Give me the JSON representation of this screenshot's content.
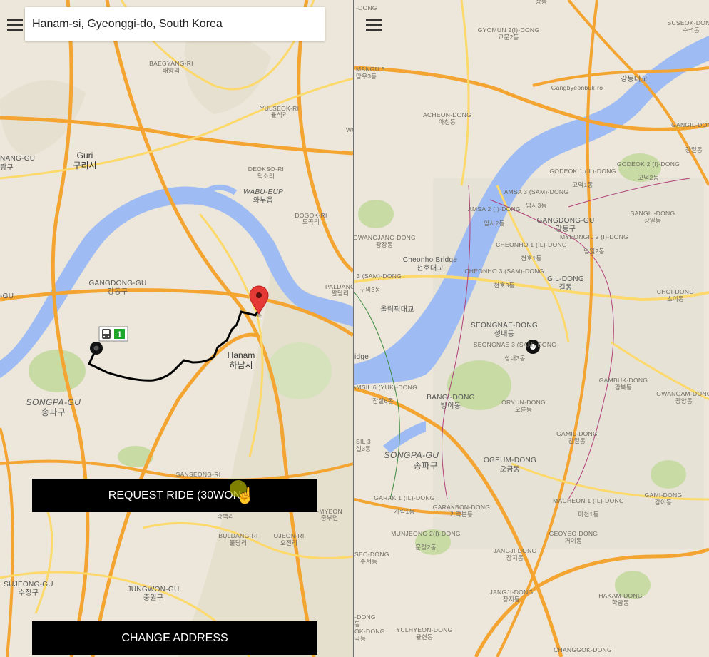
{
  "search": {
    "value": "Hanam-si, Gyeonggi-do, South Korea"
  },
  "buttons": {
    "request_ride": "REQUEST RIDE (30WON",
    "change_address": "CHANGE ADDRESS"
  },
  "left_map": {
    "transit_badge": "1",
    "labels": {
      "guri_en": "Guri",
      "guri_ko": "구리시",
      "baegyang_en": "BAEGYANG-RI",
      "baegyang_ko": "배양리",
      "yulseok_en": "YULSEOK-RI",
      "yulseok_ko": "율석리",
      "deokso_en": "DEOKSO-RI",
      "deokso_ko": "덕소리",
      "wabu_en": "WABU-EUP",
      "wabu_ko": "와부읍",
      "dogok_en": "DOGOK-RI",
      "dogok_ko": "도곡리",
      "gangdong_en": "GANGDONG-GU",
      "gangdong_ko": "강동구",
      "hanam_en": "Hanam",
      "hanam_ko": "하남시",
      "songpa_en": "SONGPA-GU",
      "songpa_ko": "송파구",
      "paldang_en": "PALDANG",
      "paldang_ko": "팔당리",
      "jungwon_en": "JUNGWON-GU",
      "jungwon_ko": "중원구",
      "sujeong_en": "SUJEONG-GU",
      "sujeong_ko": "수정구",
      "buldang_en": "BULDANG-RI",
      "buldang_ko": "불당리",
      "ojeon_en": "OJEON-RI",
      "ojeon_ko": "오전리",
      "sanseong_en": "SANSEONG-RI",
      "gwang_ko": "광벽리",
      "myeon_en": "-MYEON",
      "myeon_ko": "중부면",
      "wol_en": "WOL",
      "ang_en": "NANG-GU",
      "ang_ko": "랑구",
      "gu_en": "-GU"
    }
  },
  "right_map": {
    "labels": {
      "gyomun_en": "GYOMUN 2(I)-DONG",
      "gyomun_ko": "교문2동",
      "suseok_en": "SUSEOK-DONG",
      "suseok_ko": "수석동",
      "gangdong_bridge_ko": "강동대교",
      "gangbyeon_road": "Gangbyeonbuk-ro",
      "acheon_en": "ACHEON-DONG",
      "acheon_ko": "아천동",
      "mangu_en": "MANGU 3",
      "mangu_ko": "망우3동",
      "gangil_en": "GANGIL-DONG",
      "gangil_ko": "강일동",
      "godeok1_en": "GODEOK 1 (IL)-DONG",
      "godeok1_ko": "고덕1동",
      "godeok2_en": "GODEOK 2 (I)-DONG",
      "godeok2_ko": "고덕2동",
      "amsa3_en": "AMSA 3 (SAM)-DONG",
      "amsa3_ko": "암사3동",
      "amsa2_en": "AMSA 2 (I)-DONG",
      "amsa2_ko": "암사2동",
      "gangdong_gu_en": "GANGDONG-GU",
      "gangdong_gu_ko": "강동구",
      "sangil_en": "SANGIL-DONG",
      "sangil_ko": "상일동",
      "myeongil2_en": "MYEONGIL 2 (I)-DONG",
      "myeongil2_ko": "명일2동",
      "gwangjang_en": "GWANGJANG-DONG",
      "gwangjang_ko": "광장동",
      "cheonho_bridge_en": "Cheonho Bridge",
      "cheonho_bridge_ko": "천호대교",
      "cheonho1_en": "CHEONHO 1 (IL)-DONG",
      "cheonho1_ko": "천호1동",
      "cheonho3_en": "CHEONHO 3 (SAM)-DONG",
      "cheonho3_ko": "천호3동",
      "gildong_en": "GIL-DONG",
      "gildong_ko": "길동",
      "guui3_en": "GUUI 3 (SAM)-DONG",
      "guui3_ko": "구의3동",
      "choi_en": "CHOI-DONG",
      "choi_ko": "초이동",
      "olympic_ko": "올림픽대교",
      "seongnae_en": "SEONGNAE-DONG",
      "seongnae_ko": "성내동",
      "seongnae3_en": "SEONGNAE 3 (SAM)-DONG",
      "seongnae3_ko": "성내3동",
      "bridge_fragment": "idge",
      "jamsil6_en": "JAMSIL 6 (YUK)-DONG",
      "jamsil6_ko": "잠실6동",
      "bangi_en": "BANGI-DONG",
      "bangi_ko": "방이동",
      "oryun_en": "ORYUN-DONG",
      "oryun_ko": "오륜동",
      "gambuk_en": "GAMBUK-DONG",
      "gambuk_ko": "감북동",
      "gangwang_en": "GWANGAM-DONG",
      "gangwang_ko": "광암동",
      "jamsil3_en": "SIL 3",
      "jamsil3_ko": "실3동",
      "songpa_en": "SONGPA-GU",
      "songpa_ko": "송파구",
      "ogeum_en": "OGEUM-DONG",
      "ogeum_ko": "오금동",
      "gamil_en": "GAMIL-DONG",
      "gamil_ko": "감일동",
      "garak1_en": "GARAK 1 (IL)-DONG",
      "garak1_ko": "가락1동",
      "garakbon_en": "GARAKBON-DONG",
      "garakbon_ko": "가락본동",
      "macheon1_en": "MACHEON 1 (IL)-DONG",
      "macheon1_ko": "마천1동",
      "gami_en": "GAMI-DONG",
      "gami_ko": "감이동",
      "geoyeo_en": "GEOYEO-DONG",
      "geoyeo_ko": "거여동",
      "munjeong2_en": "MUNJEONG 2(I)-DONG",
      "munjeong2_ko": "문정2동",
      "jangji_en": "JANGJI-DONG",
      "jangji_ko": "장지동",
      "seo_en": "SEO-DONG",
      "seo_ko": "수서동",
      "jangji2_en": "JANGJI-DONG",
      "jangji2_ko": "장지동",
      "hakam_en": "HAKAM-DONG",
      "hakam_ko": "학암동",
      "yulhyeon_en": "YULHYEON-DONG",
      "yulhyeon_ko": "율현동",
      "changgok_en": "CHANGGOK-DONG",
      "ok_en": "OK-DONG",
      "ok_ko": "곡동",
      "dong_en": "-DONG",
      "dong_ko": "동",
      "top_ko": "상동",
      "top_en": "-DONG"
    }
  },
  "colors": {
    "water": "#9ebcf3",
    "highway": "#f3a431",
    "road": "#fcd96a",
    "land": "#ece7da",
    "park": "#c8dba4",
    "button_bg": "#000000",
    "marker": "#e53935"
  },
  "icons": [
    "hamburger-icon",
    "bus-icon",
    "map-pin-icon",
    "location-dot-icon",
    "hand-cursor-icon"
  ]
}
